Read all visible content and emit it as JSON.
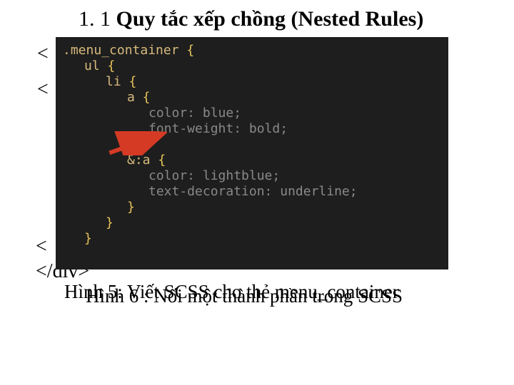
{
  "title_prefix": "1. 1 ",
  "title_bold": "Quy tắc xếp chồng (Nested Rules)",
  "bg": {
    "frag1": "<",
    "frag2": "<",
    "frag3": "<",
    "frag4": "</div>"
  },
  "caption5": "Hình 5: Viết SCSS cho thẻ menu_container",
  "caption6": "Hình 6 : Nối một thành phần trong SCSS",
  "code": {
    "l0_name": ".menu_container",
    "l0_open": " {",
    "l1_name": "ul",
    "l1_open": " {",
    "l2_name": "li",
    "l2_open": " {",
    "l3_name": "a",
    "l3_open": " {",
    "p1": "color: ",
    "v1": "blue;",
    "p2": "font-weight: ",
    "v2": "bold;",
    "l3_close": "}",
    "l4_name": "&:a",
    "l4_open": " {",
    "p3": "color: ",
    "v3": "lightblue;",
    "p4": "text-decoration: ",
    "v4": "underline;",
    "l4_close": "}",
    "l2_close": "}",
    "l1_close": "}"
  }
}
